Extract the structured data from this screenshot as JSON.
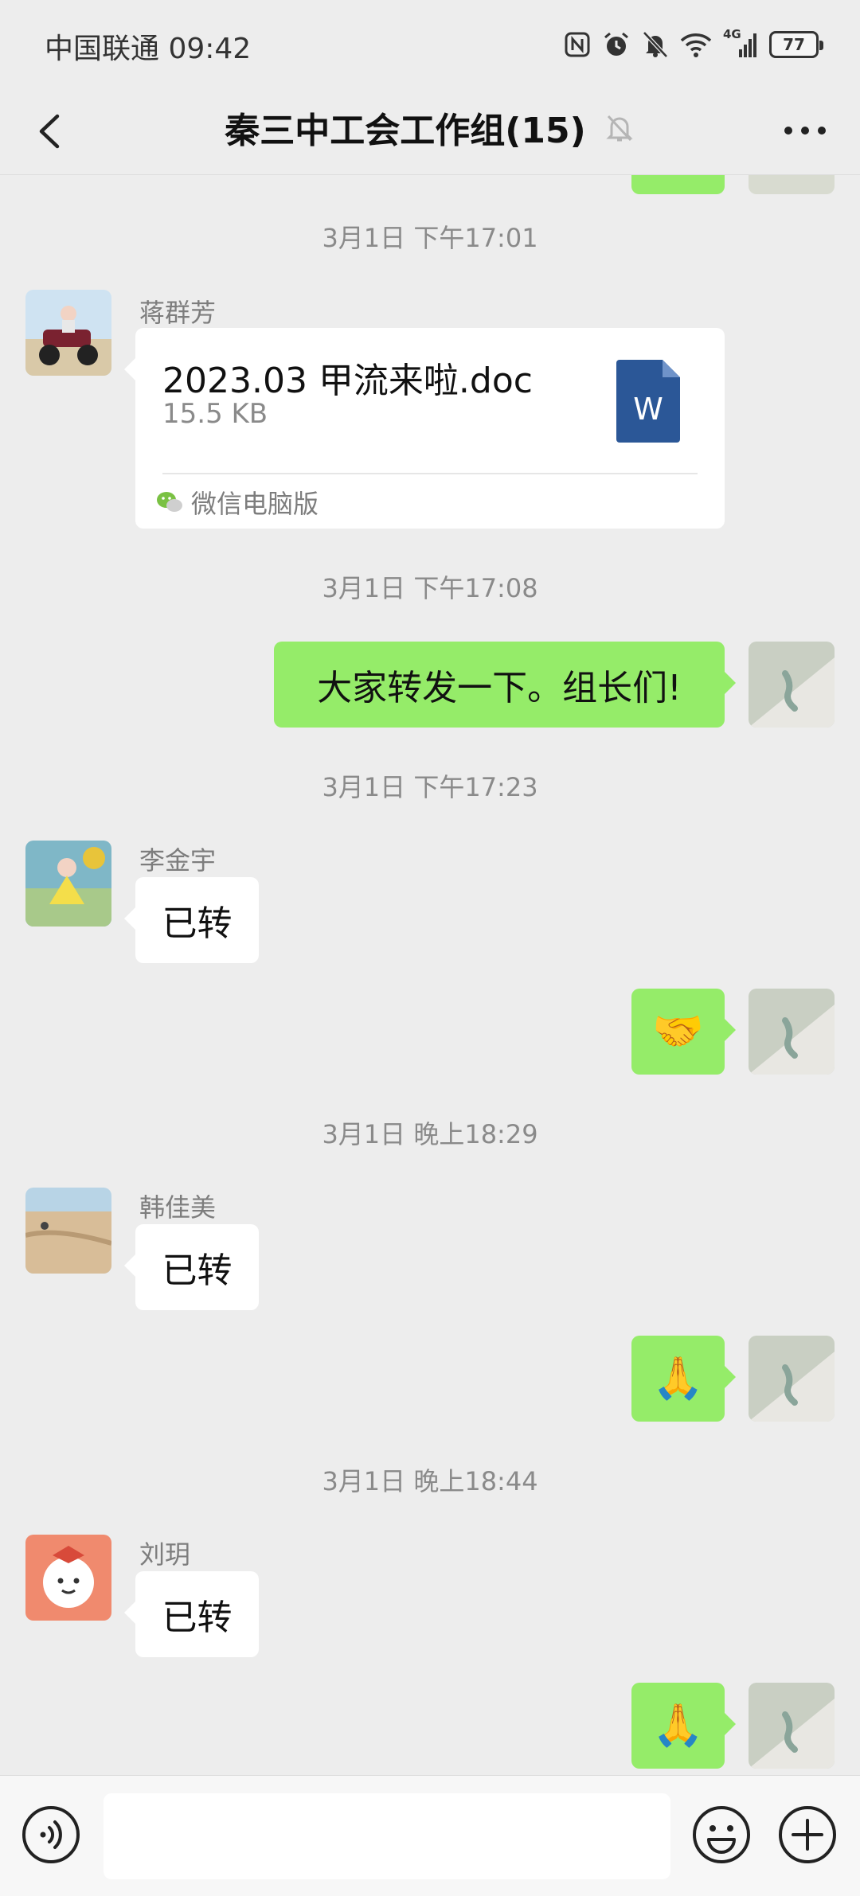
{
  "status_bar": {
    "carrier_time": "中国联通 09:42",
    "network": "4G",
    "battery": "77"
  },
  "nav": {
    "title": "秦三中工会工作组(15)"
  },
  "messages": [
    {
      "type": "time",
      "text": "3月1日 下午17:01"
    },
    {
      "type": "file",
      "sender": "蒋群芳",
      "file_name": "2023.03 甲流来啦.doc",
      "file_size": "15.5 KB",
      "file_type": "W",
      "source": "微信电脑版"
    },
    {
      "type": "time",
      "text": "3月1日 下午17:08"
    },
    {
      "type": "text_out",
      "text": "大家转发一下。组长们!"
    },
    {
      "type": "time",
      "text": "3月1日 下午17:23"
    },
    {
      "type": "text_in",
      "sender": "李金宇",
      "text": "已转"
    },
    {
      "type": "emoji_out",
      "text": "🤝"
    },
    {
      "type": "time",
      "text": "3月1日 晚上18:29"
    },
    {
      "type": "text_in",
      "sender": "韩佳美",
      "text": "已转"
    },
    {
      "type": "emoji_out",
      "text": "🙏"
    },
    {
      "type": "time",
      "text": "3月1日 晚上18:44"
    },
    {
      "type": "text_in",
      "sender": "刘玥",
      "text": "已转"
    },
    {
      "type": "emoji_out",
      "text": "🙏"
    }
  ],
  "colors": {
    "outgoing_bubble": "#95ec69",
    "incoming_bubble": "#ffffff",
    "background": "#ededed",
    "word_icon": "#2b5797"
  },
  "icons": {
    "back": "chevron-left-icon",
    "mute": "bell-off-icon",
    "more": "more-dots-icon",
    "voice": "voice-icon",
    "emoji": "smiley-icon",
    "plus": "plus-circle-icon"
  }
}
